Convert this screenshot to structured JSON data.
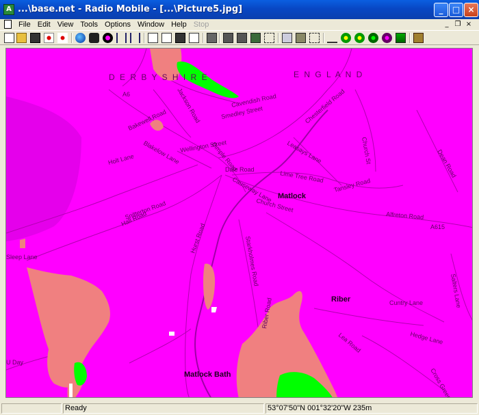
{
  "window": {
    "title": "...\\base.net - Radio Mobile - [...\\Picture5.jpg]"
  },
  "title_buttons": [
    "minimize",
    "maximize",
    "close"
  ],
  "menu": {
    "items": [
      "File",
      "Edit",
      "View",
      "Tools",
      "Options",
      "Window",
      "Help",
      "Stop"
    ],
    "disabled": [
      "Stop"
    ]
  },
  "toolbar": {
    "icons": [
      "new-icon",
      "open-icon",
      "save-icon",
      "network-properties-icon",
      "unit-properties-icon",
      "world-icon",
      "radio-link-icon",
      "polar-plot-icon",
      "merge-icon",
      "extract-icon",
      "copy-icon",
      "paste-icon",
      "print-icon",
      "copy-map-icon",
      "picture-properties-icon",
      "map-properties-icon",
      "elevation-grid-icon",
      "object-properties-icon",
      "select-icon",
      "zoom-icon",
      "signal-icon",
      "coverage-icon",
      "combined-coverage-icon",
      "rain-icon",
      "fresnel-icon",
      "info-icon",
      "exit-icon"
    ]
  },
  "map": {
    "colors": {
      "background": "#ff00ff",
      "coverage_salmon": "#f08080",
      "coverage_green": "#00ff00",
      "roads": "#b000b0"
    },
    "labels": {
      "county": "D E R B Y S H I R E",
      "country": "E N G L A N D",
      "town_main": "Matlock",
      "town_bath": "Matlock Bath",
      "town_riber": "Riber",
      "road_a6": "A6",
      "road_a615": "A615",
      "road_bakewell": "Bakewell Road",
      "road_cavendish": "Cavendish Road",
      "road_smedley": "Smedley Street",
      "road_chesterfield": "Chesterfield Road",
      "road_lime": "Lime Tree Road",
      "road_dale": "Dale Road",
      "road_causeway": "Causeway Lane",
      "road_starkholmes": "Starkholmes Road",
      "road_church": "Church Street",
      "road_riber": "Riber Road",
      "road_holt": "Holt Lane",
      "road_tansley": "Tansley Road",
      "road_alfreton": "Alfreton Road",
      "road_salters": "Salters Lane",
      "road_cuntry": "Cuntry Lane",
      "road_dimple": "Dimple Road",
      "road_wellington": "Wellington Street",
      "road_jackson": "Jackson Road",
      "road_snitterton": "Snitterton Road",
      "road_hurst": "Hurst Road",
      "road_leasays": "Leasays Lane",
      "road_blakelow": "Blakelow Lane",
      "road_church_st": "Church St",
      "road_hedge": "Hedge Lane",
      "road_lea": "Lea Road",
      "road_cross": "Cross Green",
      "road_dean": "Dean Road",
      "road_sleep": "Sleep Lane",
      "road_hall": "Hall Road",
      "road_uday": "U Day"
    }
  },
  "status": {
    "left": "",
    "message": "Ready",
    "coords": "53°07'50\"N 001°32'20\"W 235m"
  }
}
